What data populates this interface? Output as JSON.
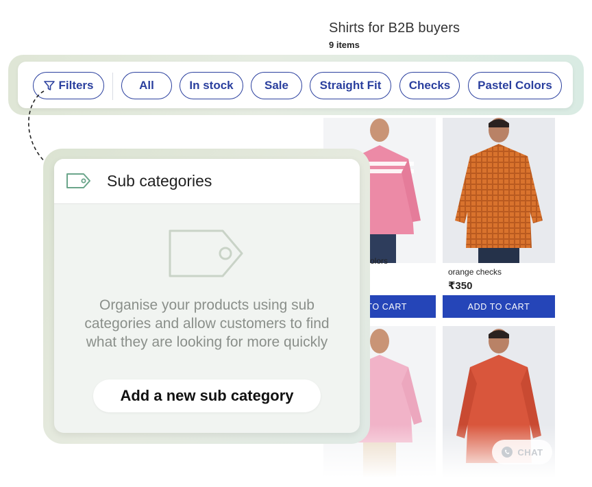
{
  "header": {
    "title": "Shirts for B2B buyers",
    "count": "9 items"
  },
  "filters": {
    "filters_label": "Filters",
    "chips": [
      "All",
      "In stock",
      "Sale",
      "Straight Fit",
      "Checks",
      "Pastel Colors"
    ],
    "accent": "#2a3f9e"
  },
  "products": [
    {
      "name": "pastel colors",
      "price": "",
      "cart": "ADD TO CART",
      "shirt_color": "#ec8aa6"
    },
    {
      "name": "orange checks",
      "price": "₹350",
      "cart": "ADD TO CART",
      "shirt_color": "#d9732d"
    },
    {
      "name": "",
      "price": "",
      "cart": "",
      "shirt_color": "#f1b3c8"
    },
    {
      "name": "",
      "price": "",
      "cart": "",
      "shirt_color": "#d9563c"
    }
  ],
  "partial_labels": {
    "product1_name_visible": "olors",
    "product1_cart_visible": "TO CART"
  },
  "subcategories": {
    "title": "Sub categories",
    "description_lines": [
      "Organise your products using sub",
      "categories and allow customers to find",
      "what they are looking for more quickly"
    ],
    "add_button": "Add a new sub category",
    "icon": "tag-icon"
  },
  "chat": {
    "label": "CHAT",
    "icon": "whatsapp-icon"
  },
  "colors": {
    "cart_button": "#2545b8",
    "panel_bg": "#f1f4f1",
    "glow": "#dfe6d6"
  }
}
